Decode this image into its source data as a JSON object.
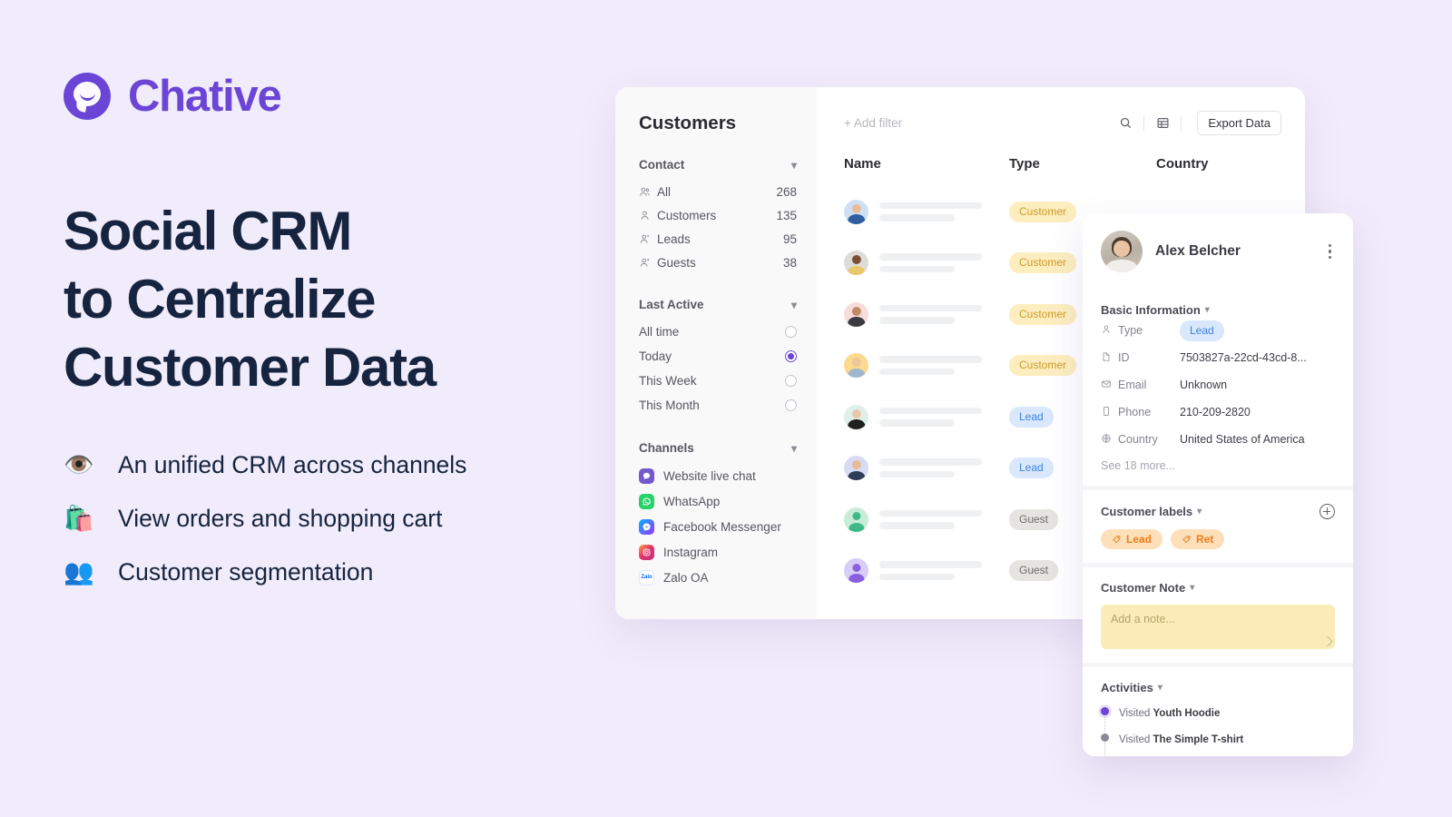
{
  "brand": {
    "name": "Chative",
    "color": "#6b46d6"
  },
  "hero": {
    "headline_lines": [
      "Social CRM",
      "to Centralize",
      "Customer Data"
    ],
    "bullets": [
      {
        "emoji": "👁️",
        "icon": "eye-icon",
        "text": "An unified CRM across channels"
      },
      {
        "emoji": "🛍️",
        "icon": "shopping-bags-icon",
        "text": "View orders and shopping cart"
      },
      {
        "emoji": "👥",
        "icon": "people-icon",
        "text": "Customer segmentation"
      }
    ]
  },
  "app": {
    "sidebar": {
      "title": "Customers",
      "contact": {
        "heading": "Contact",
        "items": [
          {
            "label": "All",
            "count": "268",
            "icon": "users-icon"
          },
          {
            "label": "Customers",
            "count": "135",
            "icon": "user-icon"
          },
          {
            "label": "Leads",
            "count": "95",
            "icon": "user-plus-icon"
          },
          {
            "label": "Guests",
            "count": "38",
            "icon": "user-guest-icon"
          }
        ]
      },
      "last_active": {
        "heading": "Last Active",
        "options": [
          {
            "label": "All time",
            "selected": false
          },
          {
            "label": "Today",
            "selected": true
          },
          {
            "label": "This Week",
            "selected": false
          },
          {
            "label": "This Month",
            "selected": false
          }
        ]
      },
      "channels": {
        "heading": "Channels",
        "items": [
          {
            "label": "Website live chat",
            "icon": "chative-icon"
          },
          {
            "label": "WhatsApp",
            "icon": "whatsapp-icon"
          },
          {
            "label": "Facebook Messenger",
            "icon": "messenger-icon"
          },
          {
            "label": "Instagram",
            "icon": "instagram-icon"
          },
          {
            "label": "Zalo OA",
            "icon": "zalo-icon"
          }
        ]
      }
    },
    "toolbar": {
      "add_filter": "+ Add filter",
      "search_icon": "search-icon",
      "table_icon": "table-view-icon",
      "export_label": "Export Data"
    },
    "table": {
      "columns": [
        "Name",
        "Type",
        "Country"
      ],
      "rows": [
        {
          "type": "Customer",
          "badge": "customer",
          "avatar": "photo-male-blue"
        },
        {
          "type": "Customer",
          "badge": "customer",
          "avatar": "photo-male-gray"
        },
        {
          "type": "Customer",
          "badge": "customer",
          "avatar": "photo-male-pink"
        },
        {
          "type": "Customer",
          "badge": "customer",
          "avatar": "photo-female-yellow"
        },
        {
          "type": "Lead",
          "badge": "lead",
          "avatar": "photo-female-mint"
        },
        {
          "type": "Lead",
          "badge": "lead",
          "avatar": "photo-male-lavender"
        },
        {
          "type": "Guest",
          "badge": "guest",
          "avatar": "placeholder-green"
        },
        {
          "type": "Guest",
          "badge": "guest",
          "avatar": "placeholder-purple"
        }
      ]
    }
  },
  "detail": {
    "name": "Alex Belcher",
    "menu_icon": "kebab-menu-icon",
    "basic_information": {
      "heading": "Basic Information",
      "fields": [
        {
          "label": "Type",
          "value": "Lead",
          "is_badge": true,
          "icon": "user-icon"
        },
        {
          "label": "ID",
          "value": "7503827a-22cd-43cd-8...",
          "icon": "document-icon"
        },
        {
          "label": "Email",
          "value": "Unknown",
          "icon": "mail-icon"
        },
        {
          "label": "Phone",
          "value": "210-209-2820",
          "icon": "phone-icon"
        },
        {
          "label": "Country",
          "value": "United States of America",
          "icon": "globe-icon"
        }
      ],
      "see_more": "See 18 more..."
    },
    "customer_labels": {
      "heading": "Customer labels",
      "add_icon": "plus-circle-icon",
      "labels": [
        "Lead",
        "Ret"
      ]
    },
    "customer_note": {
      "heading": "Customer Note",
      "placeholder": "Add a note..."
    },
    "activities": {
      "heading": "Activities",
      "items": [
        {
          "action": "Visited",
          "target": "Youth Hoodie",
          "active": true
        },
        {
          "action": "Visited",
          "target": "The Simple T-shirt",
          "active": false
        }
      ]
    }
  }
}
